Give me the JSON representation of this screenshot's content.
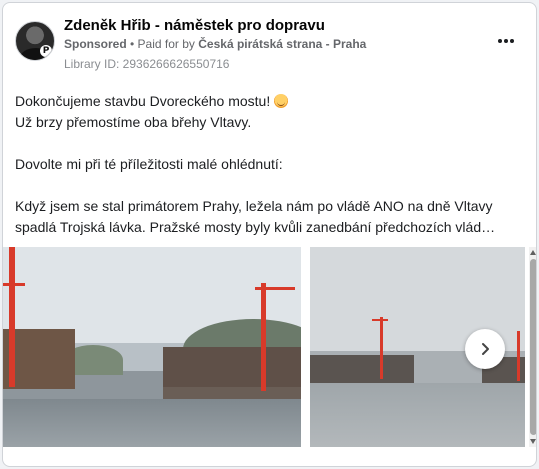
{
  "post": {
    "author": "Zdeněk Hřib - náměstek pro dopravu",
    "sponsored_label": "Sponsored",
    "separator": " • ",
    "paid_for_prefix": "Paid for by ",
    "sponsor_name": "Česká pirátská strana - Praha",
    "library_id": "Library ID: 2936266626550716",
    "text_lines": {
      "line1": "Dokončujeme stavbu Dvoreckého mostu!",
      "line2": "Už brzy přemostíme oba břehy Vltavy.",
      "line3": "Dovolte mi při té příležitosti malé ohlédnutí:",
      "line4": "Když jsem se stal primátorem Prahy, ležela nám po vládě ANO na dně Vltavy",
      "line5": "spadlá Trojská lávka. Pražské mosty byly kvůli zanedbání předchozích vlád…"
    },
    "emoji_icon": "smiling-face-emoji",
    "more_icon": "more-options-icon",
    "next_icon": "chevron-right-icon"
  },
  "colors": {
    "text": "#1c1e21",
    "secondary": "#65676b",
    "crane": "#d83a2a"
  }
}
